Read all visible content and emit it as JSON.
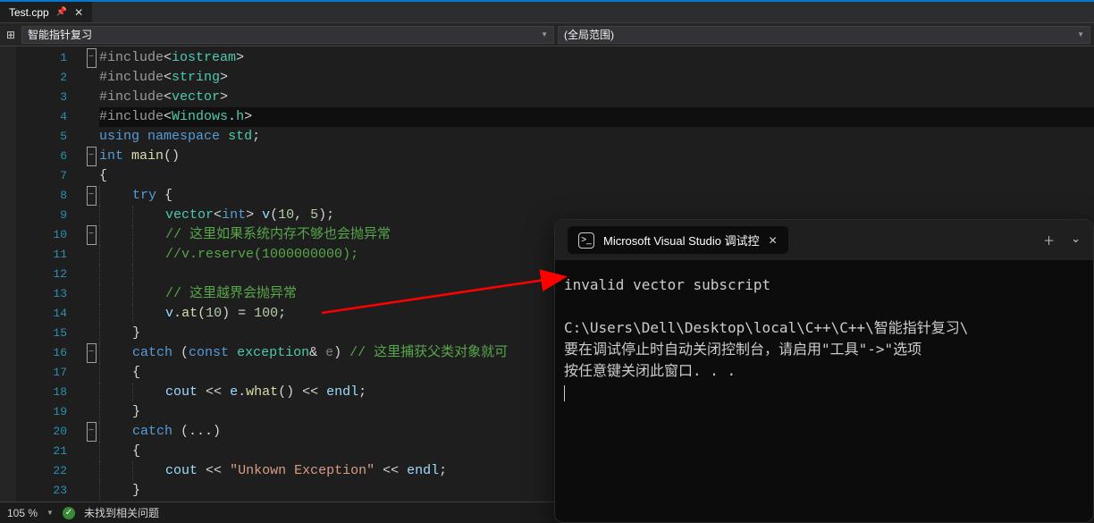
{
  "tab": {
    "filename": "Test.cpp"
  },
  "toolbar": {
    "scope_left": "智能指针复习",
    "scope_right": "(全局范围)"
  },
  "code": {
    "lines": [
      {
        "n": 1,
        "fold": "box",
        "tokens": [
          [
            "preproc",
            "#include"
          ],
          [
            "plain",
            "<"
          ],
          [
            "class",
            "iostream"
          ],
          [
            "plain",
            ">"
          ]
        ]
      },
      {
        "n": 2,
        "tokens": [
          [
            "preproc",
            "#include"
          ],
          [
            "plain",
            "<"
          ],
          [
            "class",
            "string"
          ],
          [
            "plain",
            ">"
          ]
        ]
      },
      {
        "n": 3,
        "tokens": [
          [
            "preproc",
            "#include"
          ],
          [
            "plain",
            "<"
          ],
          [
            "class",
            "vector"
          ],
          [
            "plain",
            ">"
          ]
        ]
      },
      {
        "n": 4,
        "hl": true,
        "tokens": [
          [
            "preproc",
            "#include"
          ],
          [
            "plain",
            "<"
          ],
          [
            "class",
            "Windows"
          ],
          [
            "plain",
            "."
          ],
          [
            "class",
            "h"
          ],
          [
            "plain",
            ">"
          ]
        ]
      },
      {
        "n": 5,
        "tokens": [
          [
            "keyword",
            "using"
          ],
          [
            "plain",
            " "
          ],
          [
            "keyword",
            "namespace"
          ],
          [
            "plain",
            " "
          ],
          [
            "class",
            "std"
          ],
          [
            "plain",
            ";"
          ]
        ]
      },
      {
        "n": 6,
        "fold": "box",
        "tokens": [
          [
            "keyword",
            "int"
          ],
          [
            "plain",
            " "
          ],
          [
            "func",
            "main"
          ],
          [
            "plain",
            "()"
          ]
        ]
      },
      {
        "n": 7,
        "indent": 0,
        "tokens": [
          [
            "plain",
            "{"
          ]
        ]
      },
      {
        "n": 8,
        "fold": "box",
        "indent": 1,
        "tokens": [
          [
            "keyword",
            "try"
          ],
          [
            "plain",
            " {"
          ]
        ]
      },
      {
        "n": 9,
        "indent": 2,
        "tokens": [
          [
            "class",
            "vector"
          ],
          [
            "plain",
            "<"
          ],
          [
            "keyword",
            "int"
          ],
          [
            "plain",
            "> "
          ],
          [
            "var",
            "v"
          ],
          [
            "plain",
            "("
          ],
          [
            "number",
            "10"
          ],
          [
            "plain",
            ", "
          ],
          [
            "number",
            "5"
          ],
          [
            "plain",
            ");"
          ]
        ]
      },
      {
        "n": 10,
        "fold": "box",
        "indent": 2,
        "tokens": [
          [
            "comment",
            "// 这里如果系统内存不够也会抛异常"
          ]
        ]
      },
      {
        "n": 11,
        "indent": 2,
        "tokens": [
          [
            "comment",
            "//v.reserve(1000000000);"
          ]
        ]
      },
      {
        "n": 12,
        "indent": 2,
        "tokens": []
      },
      {
        "n": 13,
        "indent": 2,
        "tokens": [
          [
            "comment",
            "// 这里越界会抛异常"
          ]
        ]
      },
      {
        "n": 14,
        "indent": 2,
        "tokens": [
          [
            "var",
            "v"
          ],
          [
            "plain",
            "."
          ],
          [
            "func",
            "at"
          ],
          [
            "plain",
            "("
          ],
          [
            "number",
            "10"
          ],
          [
            "plain",
            ") = "
          ],
          [
            "number",
            "100"
          ],
          [
            "plain",
            ";"
          ]
        ]
      },
      {
        "n": 15,
        "indent": 1,
        "tokens": [
          [
            "plain",
            "}"
          ]
        ]
      },
      {
        "n": 16,
        "fold": "box",
        "indent": 1,
        "tokens": [
          [
            "keyword",
            "catch"
          ],
          [
            "plain",
            " ("
          ],
          [
            "keyword",
            "const"
          ],
          [
            "plain",
            " "
          ],
          [
            "class",
            "exception"
          ],
          [
            "plain",
            "& "
          ],
          [
            "param",
            "e"
          ],
          [
            "plain",
            ") "
          ],
          [
            "comment",
            "// 这里捕获父类对象就可"
          ]
        ]
      },
      {
        "n": 17,
        "indent": 1,
        "tokens": [
          [
            "plain",
            "{"
          ]
        ]
      },
      {
        "n": 18,
        "indent": 2,
        "tokens": [
          [
            "var",
            "cout"
          ],
          [
            "plain",
            " << "
          ],
          [
            "var",
            "e"
          ],
          [
            "plain",
            "."
          ],
          [
            "func",
            "what"
          ],
          [
            "plain",
            "() << "
          ],
          [
            "var",
            "endl"
          ],
          [
            "plain",
            ";"
          ]
        ]
      },
      {
        "n": 19,
        "indent": 1,
        "tokens": [
          [
            "plain",
            "}"
          ]
        ]
      },
      {
        "n": 20,
        "fold": "box",
        "indent": 1,
        "tokens": [
          [
            "keyword",
            "catch"
          ],
          [
            "plain",
            " (...)"
          ]
        ]
      },
      {
        "n": 21,
        "indent": 1,
        "tokens": [
          [
            "plain",
            "{"
          ]
        ]
      },
      {
        "n": 22,
        "indent": 2,
        "tokens": [
          [
            "var",
            "cout"
          ],
          [
            "plain",
            " << "
          ],
          [
            "string",
            "\"Unkown Exception\""
          ],
          [
            "plain",
            " << "
          ],
          [
            "var",
            "endl"
          ],
          [
            "plain",
            ";"
          ]
        ]
      },
      {
        "n": 23,
        "indent": 1,
        "tokens": [
          [
            "plain",
            "}"
          ]
        ]
      }
    ]
  },
  "bottom": {
    "zoom": "105 %",
    "issues": "未找到相关问题"
  },
  "console": {
    "title": "Microsoft Visual Studio 调试控",
    "output_line1": "invalid vector subscript",
    "output_line2": "C:\\Users\\Dell\\Desktop\\local\\C++\\C++\\智能指针复习\\",
    "output_line3": "要在调试停止时自动关闭控制台，请启用\"工具\"->\"选项",
    "output_line4": "按任意键关闭此窗口. . ."
  }
}
